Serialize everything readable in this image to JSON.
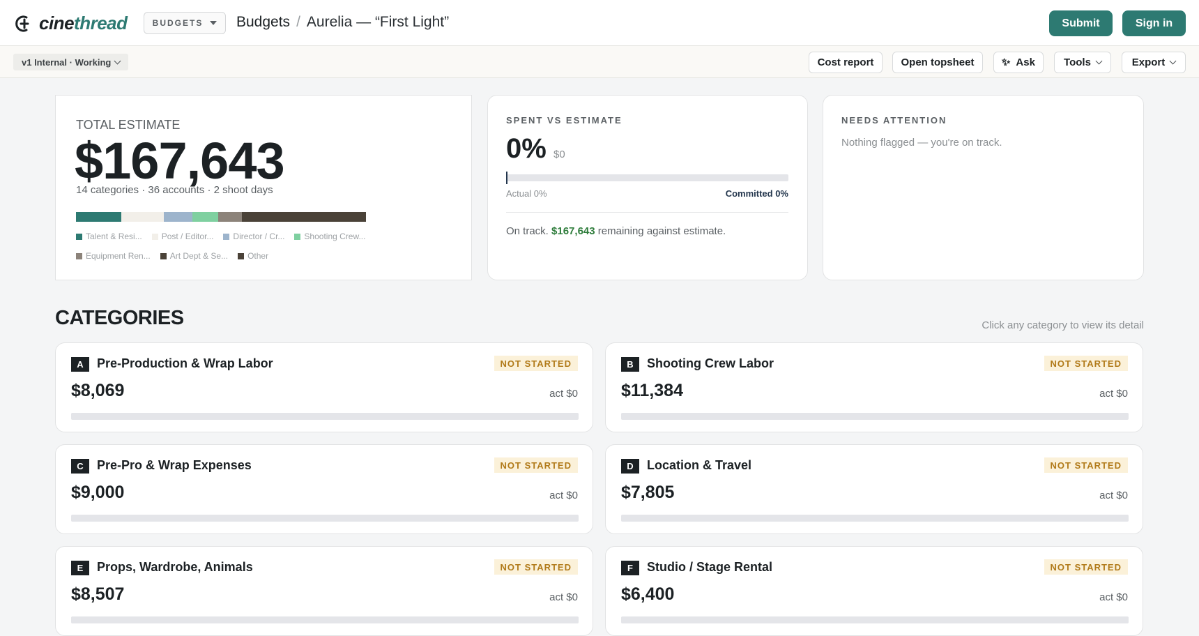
{
  "app": {
    "logo_prefix": "cine",
    "logo_suffix": "thread",
    "module_label": "BUDGETS",
    "breadcrumb_main": "Budgets",
    "breadcrumb_sep": "/",
    "breadcrumb_sub": "Aurelia — “First Light”",
    "submit_label": "Submit",
    "signin_label": "Sign in",
    "accent_color": "#2d7a72"
  },
  "toolbar": {
    "version_label": "v1 Internal · Working",
    "cost_report": "Cost report",
    "open_topsheet": "Open topsheet",
    "ask": "Ask",
    "tools": "Tools",
    "export": "Export"
  },
  "total": {
    "label": "TOTAL ESTIMATE",
    "value": "$167,643",
    "sub": "14 categories · 36 accounts · 2 shoot days",
    "breakdown": [
      {
        "name": "Talent & Resi...",
        "color": "#2d7a72",
        "share": 0.157
      },
      {
        "name": "Post / Editor...",
        "color": "#f2efe9",
        "share": 0.146
      },
      {
        "name": "Director / Cr...",
        "color": "#9db4cc",
        "share": 0.098
      },
      {
        "name": "Shooting Crew...",
        "color": "#7fd0a0",
        "share": 0.089
      },
      {
        "name": "Equipment Ren...",
        "color": "#8c837a",
        "share": 0.082
      },
      {
        "name": "Art Dept & Se...",
        "color": "#4a4238",
        "share": 0.103
      },
      {
        "name": "Other",
        "color": "#4a4238",
        "share": 0.325
      }
    ]
  },
  "spent": {
    "label": "SPENT VS ESTIMATE",
    "pct": "0%",
    "amount": "$0",
    "progress": 0,
    "actual": "Actual 0%",
    "committed": "Committed 0%",
    "ontrack_prefix": "On track.",
    "ontrack_amount": "$167,643",
    "ontrack_suffix": "remaining against estimate."
  },
  "attention": {
    "label": "NEEDS ATTENTION",
    "text": "Nothing flagged — you're on track."
  },
  "categories": {
    "heading": "CATEGORIES",
    "hint": "Click any category to view its detail",
    "items": [
      {
        "letter": "A",
        "name": "Pre-Production & Wrap Labor",
        "status": "NOT STARTED",
        "amount": "$8,069",
        "actual": "act $0",
        "progress": 0
      },
      {
        "letter": "B",
        "name": "Shooting Crew Labor",
        "status": "NOT STARTED",
        "amount": "$11,384",
        "actual": "act $0",
        "progress": 0
      },
      {
        "letter": "C",
        "name": "Pre-Pro & Wrap Expenses",
        "status": "NOT STARTED",
        "amount": "$9,000",
        "actual": "act $0",
        "progress": 0
      },
      {
        "letter": "D",
        "name": "Location & Travel",
        "status": "NOT STARTED",
        "amount": "$7,805",
        "actual": "act $0",
        "progress": 0
      },
      {
        "letter": "E",
        "name": "Props, Wardrobe, Animals",
        "status": "NOT STARTED",
        "amount": "$8,507",
        "actual": "act $0",
        "progress": 0
      },
      {
        "letter": "F",
        "name": "Studio / Stage Rental",
        "status": "NOT STARTED",
        "amount": "$6,400",
        "actual": "act $0",
        "progress": 0
      }
    ]
  }
}
